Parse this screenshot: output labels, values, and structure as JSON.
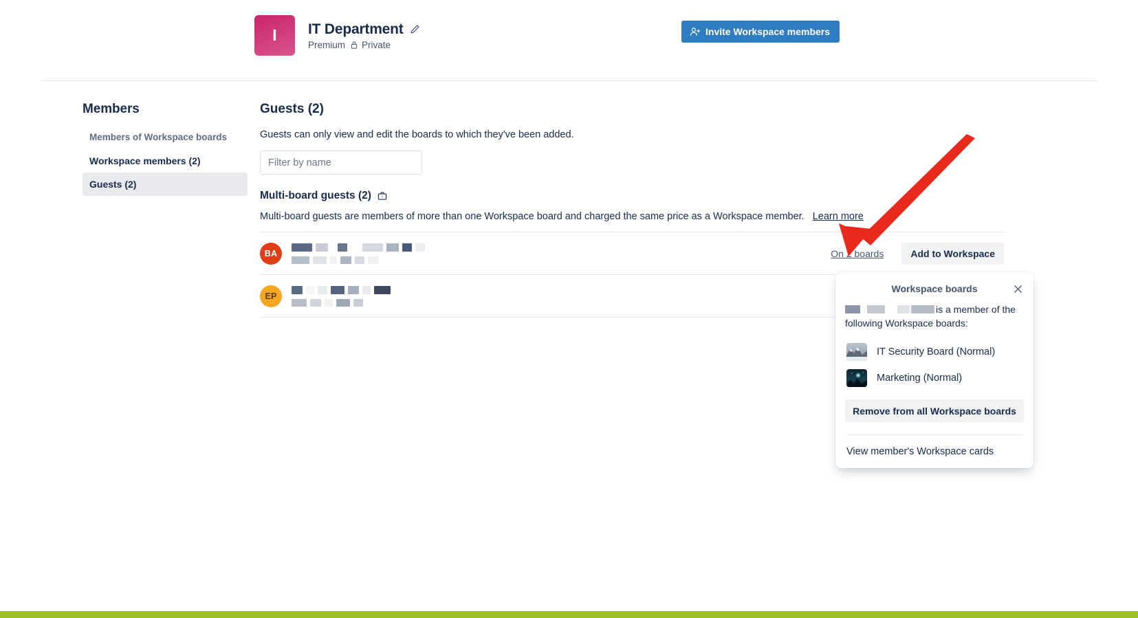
{
  "header": {
    "logo_initial": "I",
    "logo_color": "#c9256b",
    "title": "IT Department",
    "edit_icon": "pencil-icon",
    "plan": "Premium",
    "visibility": "Private",
    "visibility_icon": "lock-icon",
    "invite_button": "Invite Workspace members",
    "invite_button_icon": "person-add-icon",
    "invite_button_color": "#2f7cc1"
  },
  "sidebar": {
    "heading": "Members",
    "section_label": "Members of Workspace boards",
    "items": [
      {
        "label": "Workspace members (2)",
        "active": false
      },
      {
        "label": "Guests (2)",
        "active": true
      }
    ]
  },
  "main": {
    "title": "Guests (2)",
    "description": "Guests can only view and edit the boards to which they've been added.",
    "filter_placeholder": "Filter by name",
    "filter_value": "",
    "subsection": {
      "title": "Multi-board guests (2)",
      "icon": "briefcase-icon",
      "description": "Multi-board guests are members of more than one Workspace board and charged the same price as a Workspace member.",
      "learn_more": "Learn more"
    },
    "guests": [
      {
        "initials": "BA",
        "avatar_color": "#e03e16",
        "name_redacted": true,
        "boards_link": "On 2 boards",
        "add_button": "Add to Workspace"
      },
      {
        "initials": "EP",
        "avatar_color": "#f5a623",
        "name_redacted": true,
        "boards_link": "",
        "add_button": ""
      }
    ]
  },
  "popover": {
    "title": "Workspace boards",
    "close_icon": "close-icon",
    "body_text_suffix": "is a member of the following Workspace boards:",
    "boards": [
      {
        "name": "IT Security Board (Normal)",
        "thumb": "mountain-photo"
      },
      {
        "name": "Marketing (Normal)",
        "thumb": "night-sky-photo"
      }
    ],
    "remove_button": "Remove from all Workspace boards",
    "footer_link": "View member's Workspace cards"
  },
  "annotation": {
    "arrow_color": "#e8291c"
  },
  "footer": {
    "strip_color": "#9dc026"
  }
}
